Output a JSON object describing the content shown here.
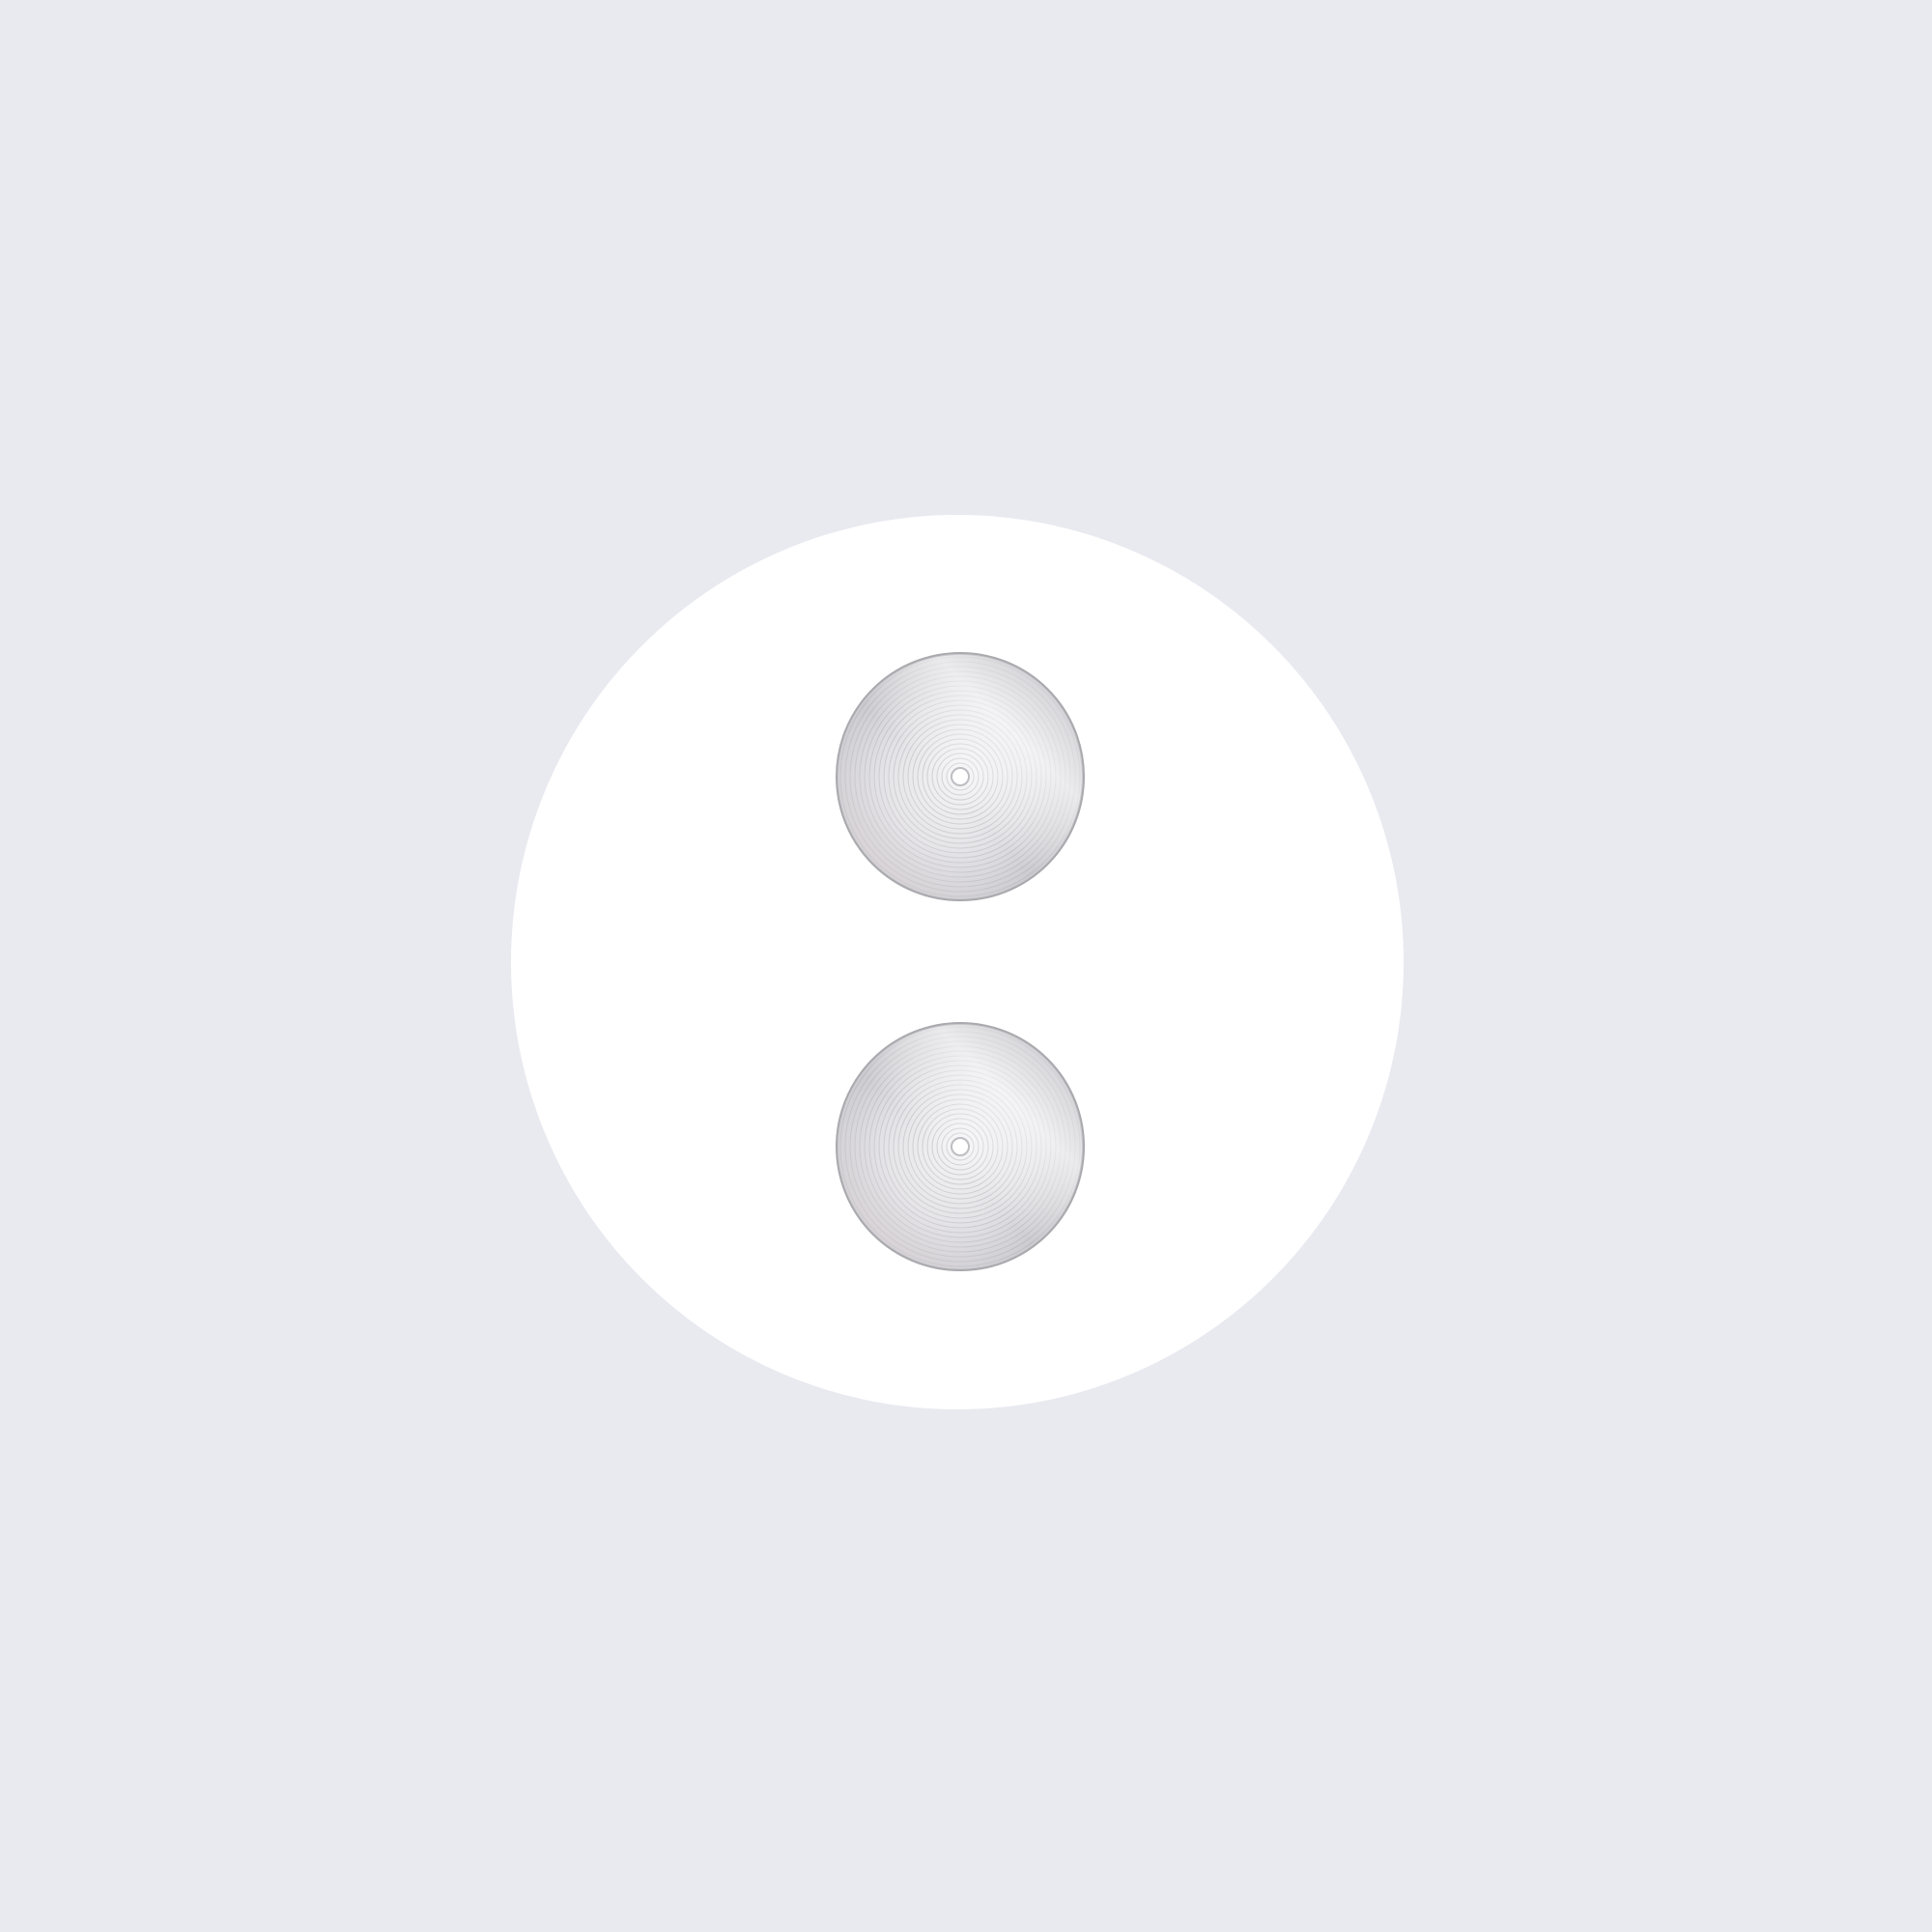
{
  "scene": {
    "description_free": true,
    "background_color": "#e9eaf0",
    "disc_color": "#ffffff",
    "pad_colors": {
      "metal_light": "#f4f4f6",
      "metal_mid": "#d9d9dd",
      "metal_dark": "#bdbdc2",
      "edge": "#a9a9ae",
      "pink_tint": "#e8d6da",
      "ring_line": "#a8a8ae"
    },
    "objects": [
      {
        "name": "white-round-base",
        "kind": "disc"
      },
      {
        "name": "metal-pad-top",
        "kind": "brushed-metal-pad"
      },
      {
        "name": "metal-pad-bottom",
        "kind": "brushed-metal-pad"
      }
    ]
  }
}
